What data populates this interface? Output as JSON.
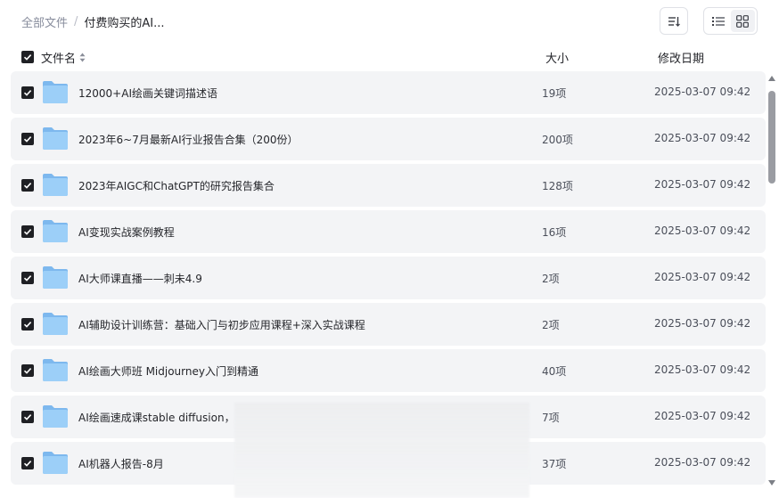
{
  "breadcrumb": {
    "root": "全部文件",
    "separator": "/",
    "current": "付费购买的AI..."
  },
  "toolbar": {
    "sort_icon": "sort-list-icon",
    "view_list_icon": "list-view-icon",
    "view_grid_icon": "grid-view-icon",
    "active_view": "grid"
  },
  "table": {
    "columns": {
      "name": "文件名",
      "size": "大小",
      "date": "修改日期"
    },
    "rows": [
      {
        "name": "12000+AI绘画关键词描述语",
        "size": "19项",
        "date": "2025-03-07 09:42",
        "checked": true
      },
      {
        "name": "2023年6~7月最新AI行业报告合集（200份）",
        "size": "200项",
        "date": "2025-03-07 09:42",
        "checked": true
      },
      {
        "name": "2023年AIGC和ChatGPT的研究报告集合",
        "size": "128项",
        "date": "2025-03-07 09:42",
        "checked": true
      },
      {
        "name": "AI变现实战案例教程",
        "size": "16项",
        "date": "2025-03-07 09:42",
        "checked": true
      },
      {
        "name": "AI大师课直播——刺未4.9",
        "size": "2项",
        "date": "2025-03-07 09:42",
        "checked": true
      },
      {
        "name": "AI辅助设计训练营：基础入门与初步应用课程+深入实战课程",
        "size": "2项",
        "date": "2025-03-07 09:42",
        "checked": true
      },
      {
        "name": "AI绘画大师班 Midjourney入门到精通",
        "size": "40项",
        "date": "2025-03-07 09:42",
        "checked": true
      },
      {
        "name": "AI绘画速成课stable diffusion，",
        "size": "7项",
        "date": "2025-03-07 09:42",
        "checked": true
      },
      {
        "name": "AI机器人报告-8月",
        "size": "37项",
        "date": "2025-03-07 09:42",
        "checked": true
      }
    ]
  },
  "colors": {
    "row_bg": "#f3f4f6",
    "folder": "#8cc4f5",
    "checkbox": "#1f2024",
    "text": "#25262b",
    "muted": "#878c9c"
  }
}
